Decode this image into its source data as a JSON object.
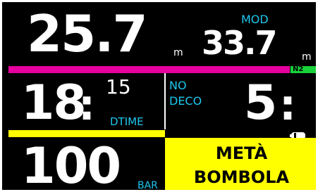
{
  "depth": {
    "value": "25.7",
    "unit": "m"
  },
  "mod": {
    "label": "MOD",
    "value": "33.7",
    "unit": "m"
  },
  "gas_tag": "N2",
  "dive_time": {
    "minutes": "18",
    "colon": ":",
    "seconds": "15",
    "label": "DTIME"
  },
  "deco": {
    "label_line1": "NO",
    "label_line2": "DECO",
    "value": "5",
    "colon": ":"
  },
  "pressure": {
    "value": "100",
    "unit": "BAR"
  },
  "warning": {
    "line1": "METÀ",
    "line2": "BOMBOLA"
  },
  "colors": {
    "background": "#000000",
    "text": "#ffffff",
    "label": "#1ec8ef",
    "tissue_bar": "#e6009e",
    "gas_bar": "#18d23a",
    "tank_bar": "#ffff00",
    "warning_bg": "#ffff00",
    "warning_text": "#000000"
  },
  "battery_icon": "battery-icon"
}
